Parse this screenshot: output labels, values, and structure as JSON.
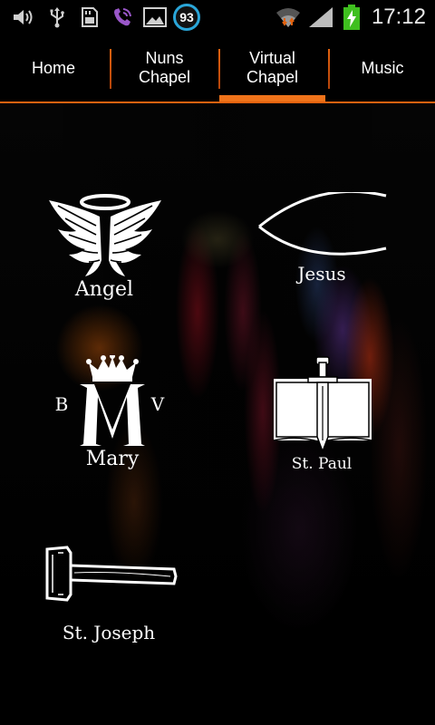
{
  "status_bar": {
    "icons": [
      "volume-icon",
      "usb-icon",
      "sd-card-icon",
      "viber-icon",
      "gallery-icon",
      "wifi-icon",
      "signal-icon",
      "battery-charging-icon"
    ],
    "badge": "93",
    "time": "17:12",
    "colors": {
      "badge_ring": "#2aa6d9",
      "battery": "#3fbf1f",
      "wifi_arrows": "#e2620f"
    }
  },
  "tabs": {
    "items": [
      {
        "label": "Home"
      },
      {
        "label": "Nuns\nChapel"
      },
      {
        "label": "Virtual\nChapel"
      },
      {
        "label": "Music"
      }
    ],
    "active": "Virtual\nChapel",
    "accent_color": "#f0731a"
  },
  "chapel": {
    "angel": {
      "label": "Angel",
      "icon": "angel-wings-icon"
    },
    "jesus": {
      "label": "Jesus",
      "icon": "ichthys-fish-icon"
    },
    "mary": {
      "label": "Mary",
      "icon": "crowned-m-icon",
      "left_letter": "B",
      "right_letter": "V"
    },
    "st_paul": {
      "label": "St. Paul",
      "icon": "book-sword-icon"
    },
    "st_joseph": {
      "label": "St. Joseph",
      "icon": "hammer-icon"
    }
  }
}
